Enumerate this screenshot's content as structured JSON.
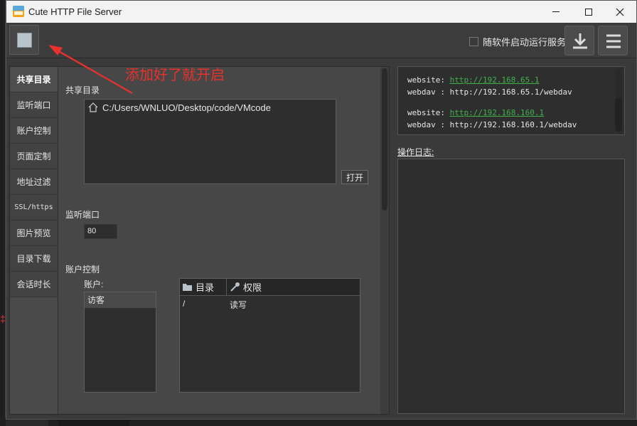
{
  "window": {
    "title": "Cute HTTP File Server",
    "controls": {
      "minimize": "minimize-icon",
      "maximize": "maximize-icon",
      "close": "close-icon"
    }
  },
  "toolbar": {
    "autostart_label": "随软件启动运行服务",
    "autostart_checked": false,
    "start_icon": "stop-square-icon",
    "download_icon": "download-icon",
    "menu_icon": "hamburger-menu-icon"
  },
  "tabs": [
    {
      "label": "共享目录",
      "active": true
    },
    {
      "label": "监听端口"
    },
    {
      "label": "账户控制"
    },
    {
      "label": "页面定制"
    },
    {
      "label": "地址过滤"
    },
    {
      "label": "SSL/https"
    },
    {
      "label": "图片预览"
    },
    {
      "label": "目录下载"
    },
    {
      "label": "会话时长"
    }
  ],
  "shared_dir": {
    "heading": "共享目录",
    "path": "C:/Users/WNLUO/Desktop/code/VMcode",
    "open_button": "打开"
  },
  "listen_port": {
    "heading": "监听端口",
    "value": "80"
  },
  "account_control": {
    "heading": "账户控制",
    "accounts_label": "账户:",
    "accounts": [
      "访客"
    ],
    "table_headers": [
      "目录",
      "权限"
    ],
    "rows": [
      {
        "dir": "/",
        "permission": "读写"
      }
    ]
  },
  "info": {
    "lines": [
      {
        "key": "website:",
        "value": "http://192.168.65.1",
        "link": true
      },
      {
        "key": "webdav :",
        "value": "http://192.168.65.1/webdav",
        "link": false
      },
      {
        "key": "website:",
        "value": "http://192.168.160.1",
        "link": true
      },
      {
        "key": "webdav :",
        "value": "http://192.168.160.1/webdav",
        "link": false
      }
    ]
  },
  "log": {
    "label": "操作日志:"
  },
  "annotation": {
    "text": "添加好了就开启"
  },
  "colors": {
    "annotation": "#e8322b",
    "link": "#3fb24a"
  }
}
